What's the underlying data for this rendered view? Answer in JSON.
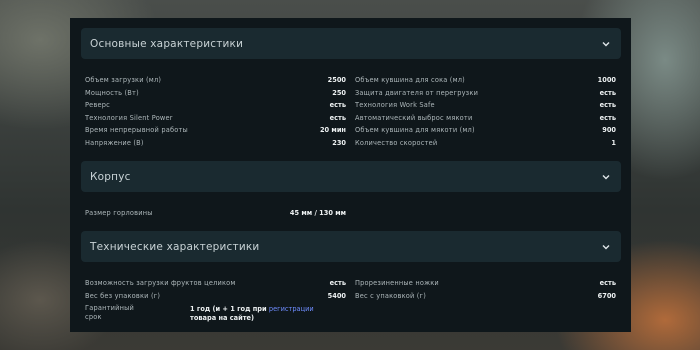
{
  "sections": [
    {
      "title": "Основные характеристики",
      "left": [
        {
          "label": "Объем загрузки (мл)",
          "value": "2500"
        },
        {
          "label": "Мощность (Вт)",
          "value": "250"
        },
        {
          "label": "Реверс",
          "value": "есть"
        },
        {
          "label": "Технология Silent Power",
          "value": "есть"
        },
        {
          "label": "Время непрерывной работы",
          "value": "20 мин"
        },
        {
          "label": "Напряжение (В)",
          "value": "230"
        }
      ],
      "right": [
        {
          "label": "Объем кувшина для сока (мл)",
          "value": "1000"
        },
        {
          "label": "Защита двигателя от перегрузки",
          "value": "есть"
        },
        {
          "label": "Технология Work Safe",
          "value": "есть"
        },
        {
          "label": "Автоматический выброс мякоти",
          "value": "есть"
        },
        {
          "label": "Объем кувшина для мякоти (мл)",
          "value": "900"
        },
        {
          "label": "Количество скоростей",
          "value": "1"
        }
      ]
    },
    {
      "title": "Корпус",
      "left": [
        {
          "label": "Размер горловины",
          "value": "45 мм / 130 мм"
        }
      ],
      "right": []
    },
    {
      "title": "Технические характеристики",
      "left": [
        {
          "label": "Возможность загрузки фруктов целиком",
          "value": "есть"
        },
        {
          "label": "Вес без упаковки (г)",
          "value": "5400"
        },
        {
          "label": "Гарантийный срок",
          "value_prefix": "1 год (и + 1 год при ",
          "value_link": "регистрации",
          "value_suffix": " товара на сайте)"
        }
      ],
      "right": [
        {
          "label": "Прорезиненные ножки",
          "value": "есть"
        },
        {
          "label": "Вес с упаковкой (г)",
          "value": "6700"
        }
      ]
    }
  ],
  "icons": {
    "expand": "chevron-down-icon"
  },
  "colors": {
    "panel": "#0f171b",
    "header": "#1a2a30",
    "link": "#6f8dff"
  }
}
